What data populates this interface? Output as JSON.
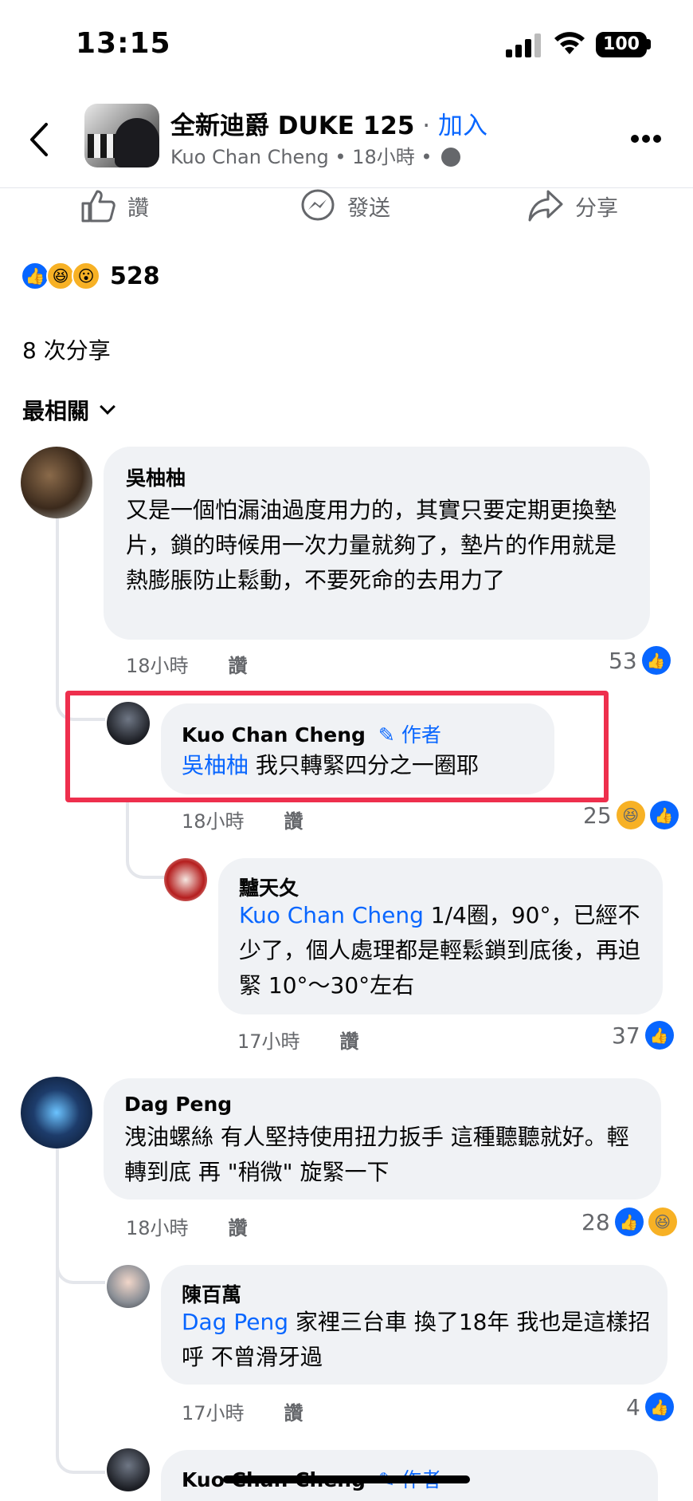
{
  "status_bar": {
    "time": "13:15",
    "battery": "100"
  },
  "header": {
    "group_name": "全新迪爵 DUKE 125",
    "separator": " · ",
    "join_label": "加入",
    "author": "Kuo Chan Cheng",
    "time": " • 18小時 •"
  },
  "actions": {
    "like": "讚",
    "send": "發送",
    "share": "分享"
  },
  "summary": {
    "reactions_count": "528",
    "shares": "8 次分享",
    "sort": "最相關"
  },
  "comments": [
    {
      "name": "吳柚柚",
      "text": "又是一個怕漏油過度用力的，其實只要定期更換墊片，鎖的時候用一次力量就夠了，墊片的作用就是熱膨脹防止鬆動，不要死命的去用力了",
      "time": "18小時",
      "like": "讚",
      "count": "53"
    },
    {
      "name": "Kuo Chan Cheng",
      "badge": "作者",
      "mention": "吳柚柚",
      "text": " 我只轉緊四分之一圈耶",
      "time": "18小時",
      "like": "讚",
      "count": "25"
    },
    {
      "name": "黸天夂",
      "mention": "Kuo Chan Cheng",
      "text": "  1/4圈，90°，已經不少了，個人處理都是輕鬆鎖到底後，再迫緊 10°～30°左右",
      "time": "17小時",
      "like": "讚",
      "count": "37"
    },
    {
      "name": "Dag Peng",
      "text": "洩油螺絲 有人堅持使用扭力扳手 這種聽聽就好。輕轉到底 再 \"稍微\" 旋緊一下",
      "time": "18小時",
      "like": "讚",
      "count": "28"
    },
    {
      "name": "陳百萬",
      "mention": "Dag Peng",
      "text": " 家裡三台車 換了18年 我也是這樣招呼 不曾滑牙過",
      "time": "17小時",
      "like": "讚",
      "count": "4"
    },
    {
      "name": "Kuo Chan Cheng",
      "badge": "作者"
    }
  ],
  "colors": {
    "accent": "#0866ff",
    "highlight": "#ee2f4d",
    "bubble": "#f0f2f5",
    "meta": "#65676b"
  }
}
